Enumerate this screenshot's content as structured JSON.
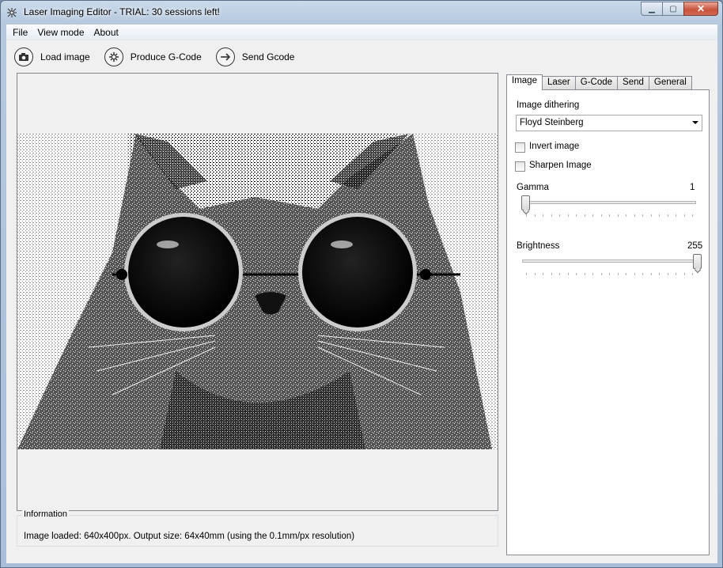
{
  "window": {
    "title": "Laser Imaging Editor - TRIAL: 30 sessions left!",
    "controls": {
      "minimize": "▁",
      "maximize": "▢",
      "close": "✕"
    }
  },
  "menu": [
    "File",
    "View mode",
    "About"
  ],
  "toolbar": {
    "load": {
      "label": "Load image",
      "icon": "camera-icon"
    },
    "produce": {
      "label": "Produce G-Code",
      "icon": "gear-icon"
    },
    "send": {
      "label": "Send Gcode",
      "icon": "arrow-right-icon"
    }
  },
  "info": {
    "legend": "Information",
    "text": "Image loaded: 640x400px. Output size: 64x40mm (using the 0.1mm/px resolution)"
  },
  "tabs": [
    "Image",
    "Laser",
    "G-Code",
    "Send",
    "General"
  ],
  "active_tab": "Image",
  "image_tab": {
    "dithering_label": "Image dithering",
    "dithering_value": "Floyd Steinberg",
    "invert_label": "Invert image",
    "invert_checked": false,
    "sharpen_label": "Sharpen Image",
    "sharpen_checked": false,
    "gamma_label": "Gamma",
    "gamma_value": "1",
    "gamma_fraction": 0.0,
    "brightness_label": "Brightness",
    "brightness_value": "255",
    "brightness_fraction": 1.0
  },
  "colors": {
    "title_bg": "#b5c8de",
    "client_bg": "#f0f0f0",
    "close_btn": "#c8523b"
  }
}
